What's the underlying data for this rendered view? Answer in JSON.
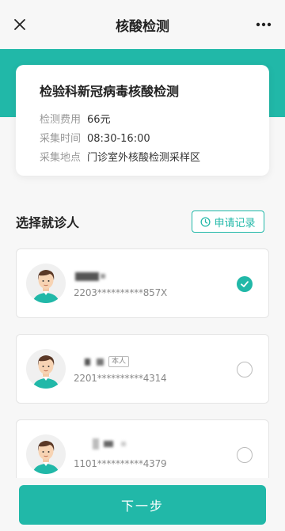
{
  "nav": {
    "title": "核酸检测",
    "close_icon": "close-icon",
    "more_icon": "more-dots-icon"
  },
  "info": {
    "title": "检验科新冠病毒核酸检测",
    "rows": [
      {
        "label": "检测费用",
        "value": "66元"
      },
      {
        "label": "采集时间",
        "value": "08:30-16:00"
      },
      {
        "label": "采集地点",
        "value": "门诊室外核酸检测采样区"
      }
    ]
  },
  "patients_section": {
    "title": "选择就诊人",
    "records_button": "申请记录",
    "records_icon": "clock-icon"
  },
  "patients": [
    {
      "id_masked": "2203**********857X",
      "selected": true,
      "badge": ""
    },
    {
      "id_masked": "2201**********4314",
      "selected": false,
      "badge": "本人"
    },
    {
      "id_masked": "1101**********4379",
      "selected": false,
      "badge": ""
    }
  ],
  "footer": {
    "next_label": "下一步"
  },
  "colors": {
    "accent": "#21b8a8",
    "background": "#f7f7f7"
  }
}
